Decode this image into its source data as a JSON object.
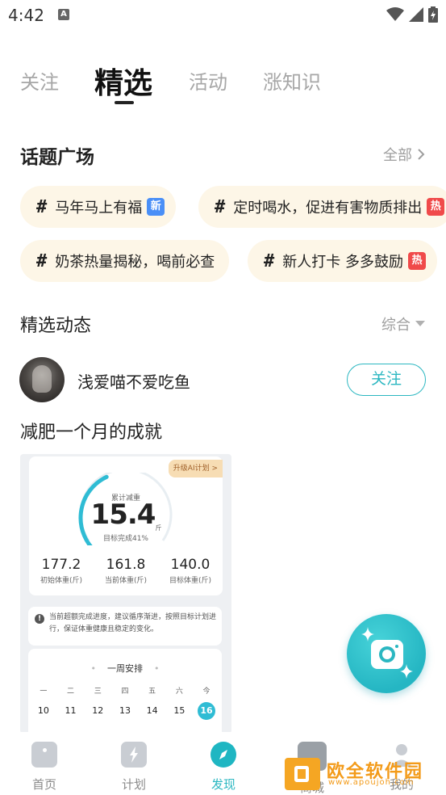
{
  "status_bar": {
    "time": "4:42",
    "notification_glyph": "A"
  },
  "top_tabs": [
    {
      "label": "关注",
      "active": false
    },
    {
      "label": "精选",
      "active": true
    },
    {
      "label": "活动",
      "active": false
    },
    {
      "label": "涨知识",
      "active": false
    }
  ],
  "topics": {
    "title": "话题广场",
    "more_label": "全部",
    "chips": [
      {
        "hash": "#",
        "text": "马年马上有福",
        "badge": "新"
      },
      {
        "hash": "#",
        "text": "定时喝水，促进有害物质排出",
        "badge": "热"
      },
      {
        "hash": "#",
        "text": "奶茶热量揭秘，喝前必查",
        "badge": ""
      },
      {
        "hash": "#",
        "text": "新人打卡 多多鼓励",
        "badge": "热"
      }
    ]
  },
  "feed": {
    "title": "精选动态",
    "sort_label": "综合"
  },
  "post": {
    "username": "浅爱喵不爱吃鱼",
    "follow_label": "关注",
    "title": "减肥一个月的成就",
    "image": {
      "upgrade_label": "升级AI计划 >",
      "center_label": "累计减重",
      "total_lost": "15.4",
      "unit": "斤",
      "goal_label": "目标完成41%",
      "goal_progress": 0.41,
      "stats": [
        {
          "value": "177.2",
          "label": "初始体重(斤)"
        },
        {
          "value": "161.8",
          "label": "当前体重(斤)"
        },
        {
          "value": "140.0",
          "label": "目标体重(斤)"
        }
      ],
      "tip": "当前超额完成进度，建议循序渐进，按照目标计划进行，保证体重健康且稳定的变化。",
      "week_title": "一周安排",
      "weekdays": [
        "一",
        "二",
        "三",
        "四",
        "五",
        "六",
        "今"
      ],
      "dates": [
        "10",
        "11",
        "12",
        "13",
        "14",
        "15",
        "16"
      ]
    }
  },
  "bottom_nav": [
    {
      "label": "首页",
      "icon": "home-icon",
      "active": false
    },
    {
      "label": "计划",
      "icon": "plan-icon",
      "active": false
    },
    {
      "label": "发现",
      "icon": "discover-icon",
      "active": true
    },
    {
      "label": "商城",
      "icon": "shop-icon",
      "active": false
    },
    {
      "label": "我的",
      "icon": "profile-icon",
      "active": false
    }
  ],
  "watermark": {
    "title": "欧全软件园",
    "url": "www.apoujoh.com"
  },
  "colors": {
    "accent": "#2bb7c1",
    "chip_bg": "#fdf6e7",
    "badge_new": "#4a8ff7",
    "badge_hot": "#f04a4a"
  }
}
